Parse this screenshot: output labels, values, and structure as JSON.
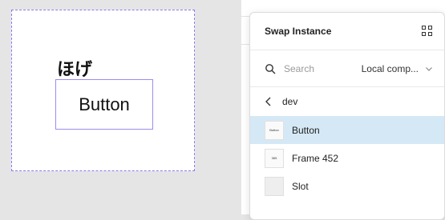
{
  "canvas": {
    "text": "ほげ",
    "button_label": "Button"
  },
  "popover": {
    "title": "Swap Instance",
    "search": {
      "placeholder": "Search"
    },
    "library_select": "Local comp...",
    "breadcrumb": "dev",
    "items": [
      {
        "label": "Button",
        "thumb": "Button",
        "selected": true
      },
      {
        "label": "Frame 452",
        "thumb": "365",
        "selected": false
      },
      {
        "label": "Slot",
        "thumb": "",
        "selected": false
      }
    ]
  },
  "colors": {
    "selection": "#d5e8f6",
    "frame_outline": "#8b7bf0"
  }
}
